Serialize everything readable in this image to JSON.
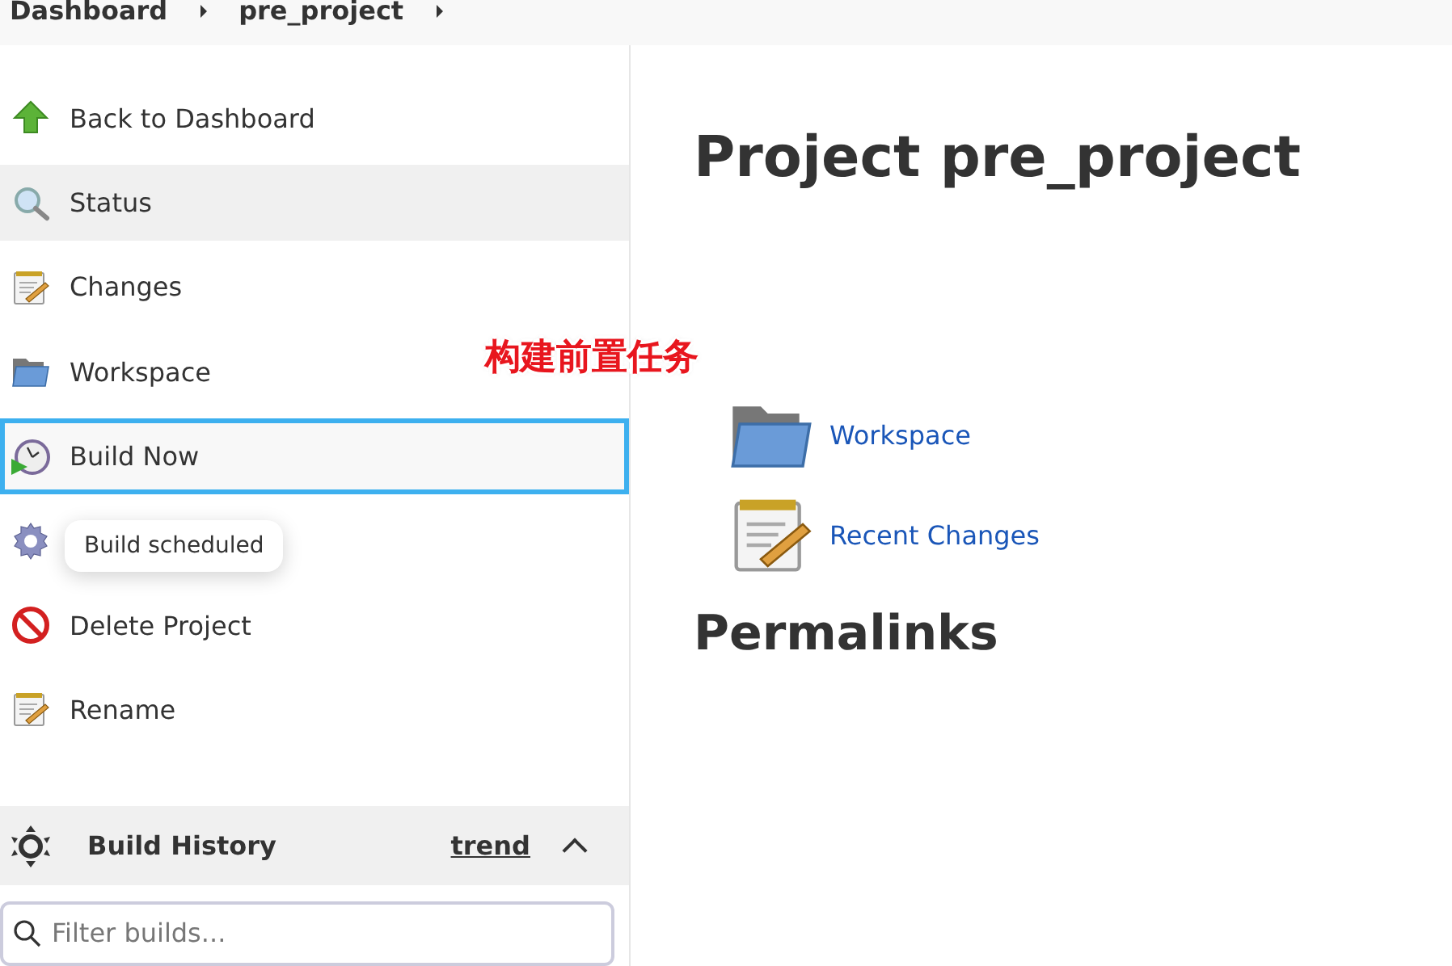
{
  "breadcrumbs": [
    {
      "label": "Dashboard"
    },
    {
      "label": "pre_project"
    }
  ],
  "sidebar": {
    "items": [
      {
        "kind": "up-arrow",
        "label": "Back to Dashboard",
        "highlighted": false,
        "focused": false
      },
      {
        "kind": "magnifier",
        "label": "Status",
        "highlighted": true,
        "focused": false
      },
      {
        "kind": "notepad",
        "label": "Changes",
        "highlighted": false,
        "focused": false
      },
      {
        "kind": "folder",
        "label": "Workspace",
        "highlighted": false,
        "focused": false
      },
      {
        "kind": "clock",
        "label": "Build Now",
        "highlighted": false,
        "focused": true
      },
      {
        "kind": "gear",
        "highlighted": false,
        "focused": false
      },
      {
        "kind": "no-entry",
        "label": "Delete Project",
        "highlighted": false,
        "focused": false
      },
      {
        "kind": "notepad",
        "label": "Rename",
        "highlighted": false,
        "focused": false
      }
    ],
    "tooltip": "Build scheduled",
    "build_history": {
      "title": "Build History",
      "trend": "trend",
      "expanded": true
    },
    "filter": {
      "placeholder": "Filter builds..."
    }
  },
  "main": {
    "title": "Project pre_project",
    "annotation": "构建前置任务",
    "links": [
      {
        "kind": "folder",
        "label": "Workspace"
      },
      {
        "kind": "notepad",
        "label": "Recent Changes"
      }
    ],
    "permalinks_heading": "Permalinks"
  }
}
